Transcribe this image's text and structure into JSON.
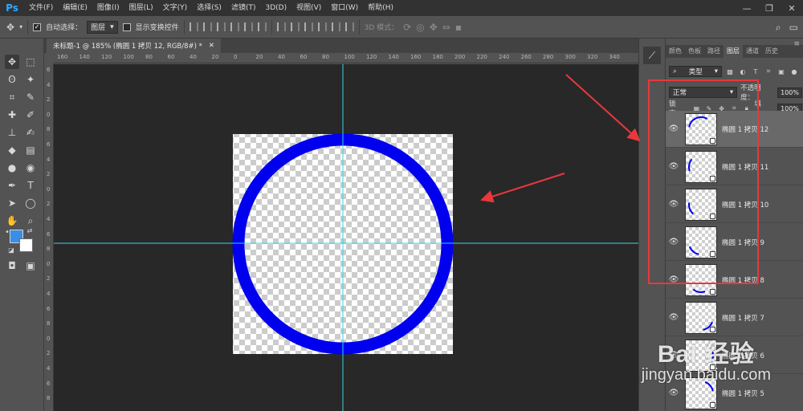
{
  "app": {
    "logo": "Ps"
  },
  "menu": [
    "文件(F)",
    "编辑(E)",
    "图像(I)",
    "图层(L)",
    "文字(Y)",
    "选择(S)",
    "滤镜(T)",
    "3D(D)",
    "视图(V)",
    "窗口(W)",
    "帮助(H)"
  ],
  "window_controls": {
    "minimize": "—",
    "restore": "❐",
    "close": "✕"
  },
  "options": {
    "auto_select_label": "自动选择：",
    "auto_select_value": "图层",
    "show_transform_label": "显示变换控件",
    "mode_3d_label": "3D 模式："
  },
  "document": {
    "tab_title": "未标题-1 @ 185% (椭圆 1 拷贝 12, RGB/8#) *",
    "tab_close": "✕"
  },
  "rulers": {
    "top": [
      "160",
      "140",
      "120",
      "100",
      "80",
      "60",
      "40",
      "20",
      "0",
      "20",
      "40",
      "60",
      "80",
      "100",
      "120",
      "140",
      "160",
      "180",
      "200",
      "220",
      "240",
      "260",
      "280",
      "300",
      "320",
      "340"
    ],
    "left": [
      "6",
      "4",
      "2",
      "0",
      "8",
      "6",
      "4",
      "2",
      "0",
      "2",
      "4",
      "6",
      "8",
      "0",
      "2",
      "4",
      "6",
      "8",
      "0",
      "2",
      "4",
      "6",
      "8"
    ]
  },
  "panel": {
    "tabs": [
      "颜色",
      "色板",
      "路径",
      "图层",
      "通道",
      "历史"
    ],
    "active_tab": "图层",
    "filter_label": "类型",
    "blend_mode": "正常",
    "opacity_label": "不透明度：",
    "opacity_value": "100%",
    "lock_label": "锁定：",
    "fill_label": "填充：",
    "fill_value": "100%"
  },
  "layers": [
    {
      "name": "椭圆 1 拷贝 12",
      "arc_start": 280,
      "arc_end": 30,
      "selected": true
    },
    {
      "name": "椭圆 1 拷贝 11",
      "arc_start": 250,
      "arc_end": 310,
      "selected": false
    },
    {
      "name": "椭圆 1 拷贝 10",
      "arc_start": 220,
      "arc_end": 280,
      "selected": false
    },
    {
      "name": "椭圆 1 拷贝 9",
      "arc_start": 190,
      "arc_end": 250,
      "selected": false
    },
    {
      "name": "椭圆 1 拷贝 8",
      "arc_start": 160,
      "arc_end": 220,
      "selected": false
    },
    {
      "name": "椭圆 1 拷贝 7",
      "arc_start": 110,
      "arc_end": 170,
      "selected": false
    },
    {
      "name": "椭圆 1 拷贝 6",
      "arc_start": 60,
      "arc_end": 120,
      "selected": false
    },
    {
      "name": "椭圆 1 拷贝 5",
      "arc_start": 20,
      "arc_end": 80,
      "selected": false
    }
  ],
  "colors": {
    "foreground": "#3b8de6",
    "background": "#ffffff",
    "ring": "#0000ee",
    "guide": "#35d6e6",
    "annotation": "#e8383d"
  },
  "watermark": {
    "brand": "Bai 经验",
    "url": "jingyan.baidu.com"
  }
}
